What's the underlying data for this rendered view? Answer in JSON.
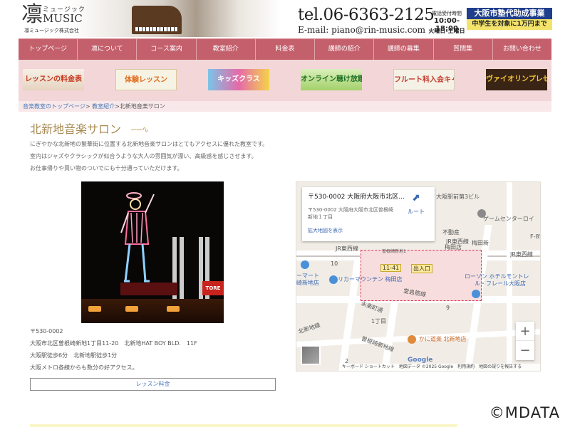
{
  "header": {
    "logo_kanji": "凛",
    "logo_ruby": "ミュージック",
    "logo_en": "MUSIC",
    "logo_corp": "凛ミュージック株式会社",
    "tel": "tel.06-6363-2125",
    "email": "E-mail: piano@rin-music.com",
    "hours_label": "電話受付時間",
    "hours_time": "10:00-18:00",
    "hours_days": "火曜日-土曜日",
    "subsidy_top": "大阪市塾代助成事業",
    "subsidy_bottom": "中学生を対象に1万円まで"
  },
  "nav": {
    "items": [
      {
        "label": "トップページ"
      },
      {
        "label": "凛について"
      },
      {
        "label": "コース案内"
      },
      {
        "label": "教室紹介"
      },
      {
        "label": "料金表"
      },
      {
        "label": "講師の紹介"
      },
      {
        "label": "講師の募集"
      },
      {
        "label": "質問集"
      },
      {
        "label": "お問い合わせ"
      }
    ]
  },
  "banners": {
    "items": [
      {
        "label": "レッスンの料金表"
      },
      {
        "label": "体験レッスン"
      },
      {
        "label": "キッズクラス"
      },
      {
        "label": "オンライン聴け放題レッスン"
      },
      {
        "label": "フルート科入会キャンペーン"
      },
      {
        "label": "ヴァイオリンプレゼントキャンペーン"
      }
    ]
  },
  "breadcrumb": {
    "home": "音楽教室のトップページ",
    "sep": ">",
    "parent": "教室紹介",
    "current": "北新地音楽サロン"
  },
  "main": {
    "title": "北新地音楽サロン",
    "desc1": "にぎやかな北新地の繁華街に位置する北新地音楽サロンはとてもアクセスに優れた教室です。",
    "desc2": "室内はジャズやクラシックが似合うような大人の雰囲気が漂い、高級感を感じさせます。",
    "desc3": "お仕事帰りや買い物のついでにも十分通っていただけます。",
    "addr_postal": "〒530-0002",
    "addr_street": "大阪市北区曽根崎新地1丁目11-20　北新地HAT BOY BLD.　11F",
    "addr_access1": "大阪駅徒歩6分　北新地駅徒歩1分",
    "addr_access2": "大阪メトロ各線からも数分の好アクセス。",
    "lesson_button": "レッスン料金"
  },
  "photo": {
    "sign_text": "TORE"
  },
  "map": {
    "card_title": "〒530-0002 大阪府大阪市北区...",
    "card_sub1": "〒530-0002 大阪府大阪市北区曽根崎",
    "card_sub2": "新地１丁目",
    "card_link": "拡大地図を表示",
    "route_label": "ルート",
    "labels": {
      "osaka_daisan": "大阪駅前第3ビル",
      "game_center": "ゲームセンターロイ",
      "jr_tozai": "JR東西線",
      "fudosan": "不動産",
      "umeda": "梅田店",
      "umeda_shinmichi": "梅田新",
      "sonezaki_shinchi1": "曽根崎新地1",
      "jr_tozai2": "JR東西線",
      "num10": "10",
      "num9": "9",
      "num2": "2",
      "chome1": "1丁目",
      "label_1141": "11-41",
      "exit": "出入口",
      "rika_mountain": "リカーマウンテン 梅田店",
      "mart": "ーマート",
      "sakishinchi": "崎新地店",
      "kitashinchi_line": "北新地線",
      "naga_dori": "永楽町通",
      "dojima": "堂島筋線",
      "sonezaki_shinchi_line": "曽根崎新地線",
      "kani_doraku": "かに道楽 北新地店",
      "hotel": "ローソン ホテルモントレ",
      "hotel2": "ル・フレール大阪店",
      "f85": "F-85",
      "umeda2": "梅田"
    },
    "zoom_in": "+",
    "zoom_out": "−",
    "footer": "キーボード ショートカット　地図データ ©2025 Google　利用規約　地図の誤りを報告する",
    "google": "Google"
  },
  "watermark": "©MDATA",
  "colors": {
    "nav_bg": "#c4606c",
    "banner_bg": "#f2d6d8",
    "title_gold": "#a88a52",
    "link_blue": "#4a78b5"
  }
}
